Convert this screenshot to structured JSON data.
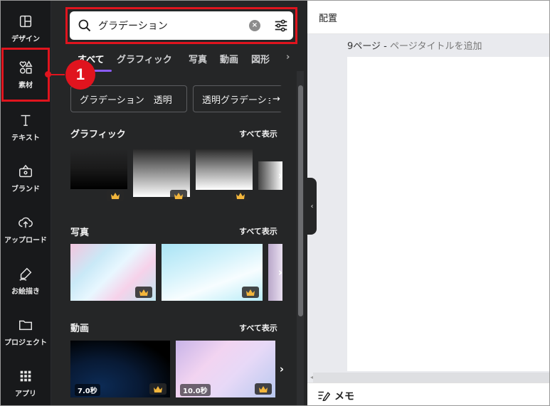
{
  "sidebar": {
    "items": [
      {
        "label": "デザイン",
        "icon": "layout-icon"
      },
      {
        "label": "素材",
        "icon": "elements-icon"
      },
      {
        "label": "テキスト",
        "icon": "text-icon"
      },
      {
        "label": "ブランド",
        "icon": "brand-icon"
      },
      {
        "label": "アップロード",
        "icon": "upload-icon"
      },
      {
        "label": "お絵描き",
        "icon": "draw-icon"
      },
      {
        "label": "プロジェクト",
        "icon": "folder-icon"
      },
      {
        "label": "アプリ",
        "icon": "apps-icon"
      }
    ]
  },
  "search": {
    "value": "グラデーション"
  },
  "tabs": [
    "すべて",
    "グラフィック",
    "写真",
    "動画",
    "図形"
  ],
  "chips": [
    "グラデーション　透明",
    "透明グラデーショ"
  ],
  "sections": {
    "graphics": {
      "title": "グラフィック",
      "show_all": "すべて表示"
    },
    "photos": {
      "title": "写真",
      "show_all": "すべて表示"
    },
    "videos": {
      "title": "動画",
      "show_all": "すべて表示"
    }
  },
  "videos": [
    {
      "duration": "7.0秒"
    },
    {
      "duration": "10.0秒"
    }
  ],
  "editor": {
    "position_label": "配置",
    "page_number": "9ページ -",
    "page_title_placeholder": "ページタイトルを追加",
    "notes_label": "メモ"
  },
  "annotation": {
    "step": "1"
  },
  "colors": {
    "accent_red": "#e0141e",
    "panel_bg": "#252627",
    "rail_bg": "#18191b",
    "premium_crown": "#f3b63c"
  }
}
